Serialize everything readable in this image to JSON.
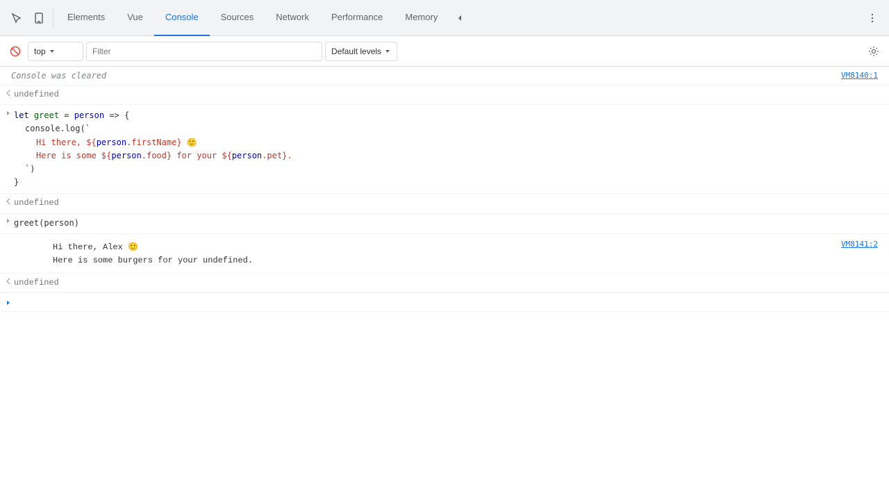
{
  "toolbar": {
    "tabs": [
      {
        "id": "elements",
        "label": "Elements",
        "active": false
      },
      {
        "id": "vue",
        "label": "Vue",
        "active": false
      },
      {
        "id": "console",
        "label": "Console",
        "active": true
      },
      {
        "id": "sources",
        "label": "Sources",
        "active": false
      },
      {
        "id": "network",
        "label": "Network",
        "active": false
      },
      {
        "id": "performance",
        "label": "Performance",
        "active": false
      },
      {
        "id": "memory",
        "label": "Memory",
        "active": false
      }
    ]
  },
  "console": {
    "context": "top",
    "filter_placeholder": "Filter",
    "levels_label": "Default levels",
    "cleared_text": "Console was cleared",
    "vm_link_1": "VM8140:1",
    "vm_link_2": "VM8141:2",
    "undefined_label": "undefined",
    "greet_call": "greet(person)"
  },
  "icons": {
    "cursor": "↖",
    "mobile": "▭",
    "dots_v": "⋮",
    "chevron_down": "▾",
    "chevron_right_blue": "❯",
    "chevron_left": "❮",
    "no_entry": "⊘",
    "settings": "⚙",
    "more": "≫"
  }
}
